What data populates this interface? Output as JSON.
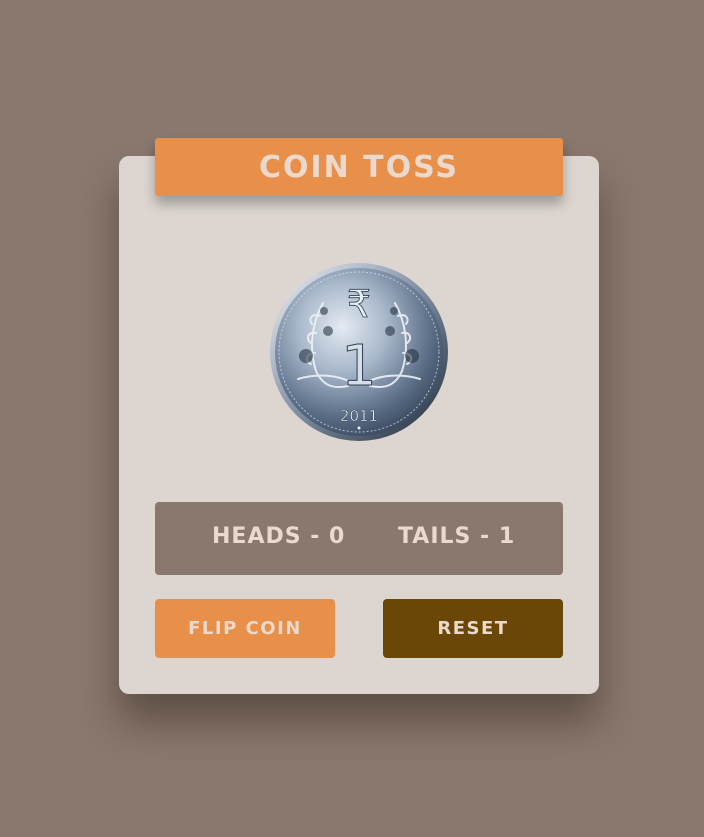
{
  "app": {
    "title": "COIN TOSS"
  },
  "coin": {
    "icon": "rupee-coin-icon",
    "face": "tails",
    "symbol": "₹",
    "denomination": "1",
    "year": "2011"
  },
  "score": {
    "heads_label": "HEADS - 0",
    "tails_label": "TAILS - 1",
    "heads": 0,
    "tails": 1
  },
  "buttons": {
    "flip_label": "FLIP COIN",
    "reset_label": "RESET"
  },
  "colors": {
    "background": "#8a786e",
    "card": "#ddd6d0",
    "accent": "#e8904a",
    "reset": "#6a4706",
    "text": "#ead9cc"
  }
}
